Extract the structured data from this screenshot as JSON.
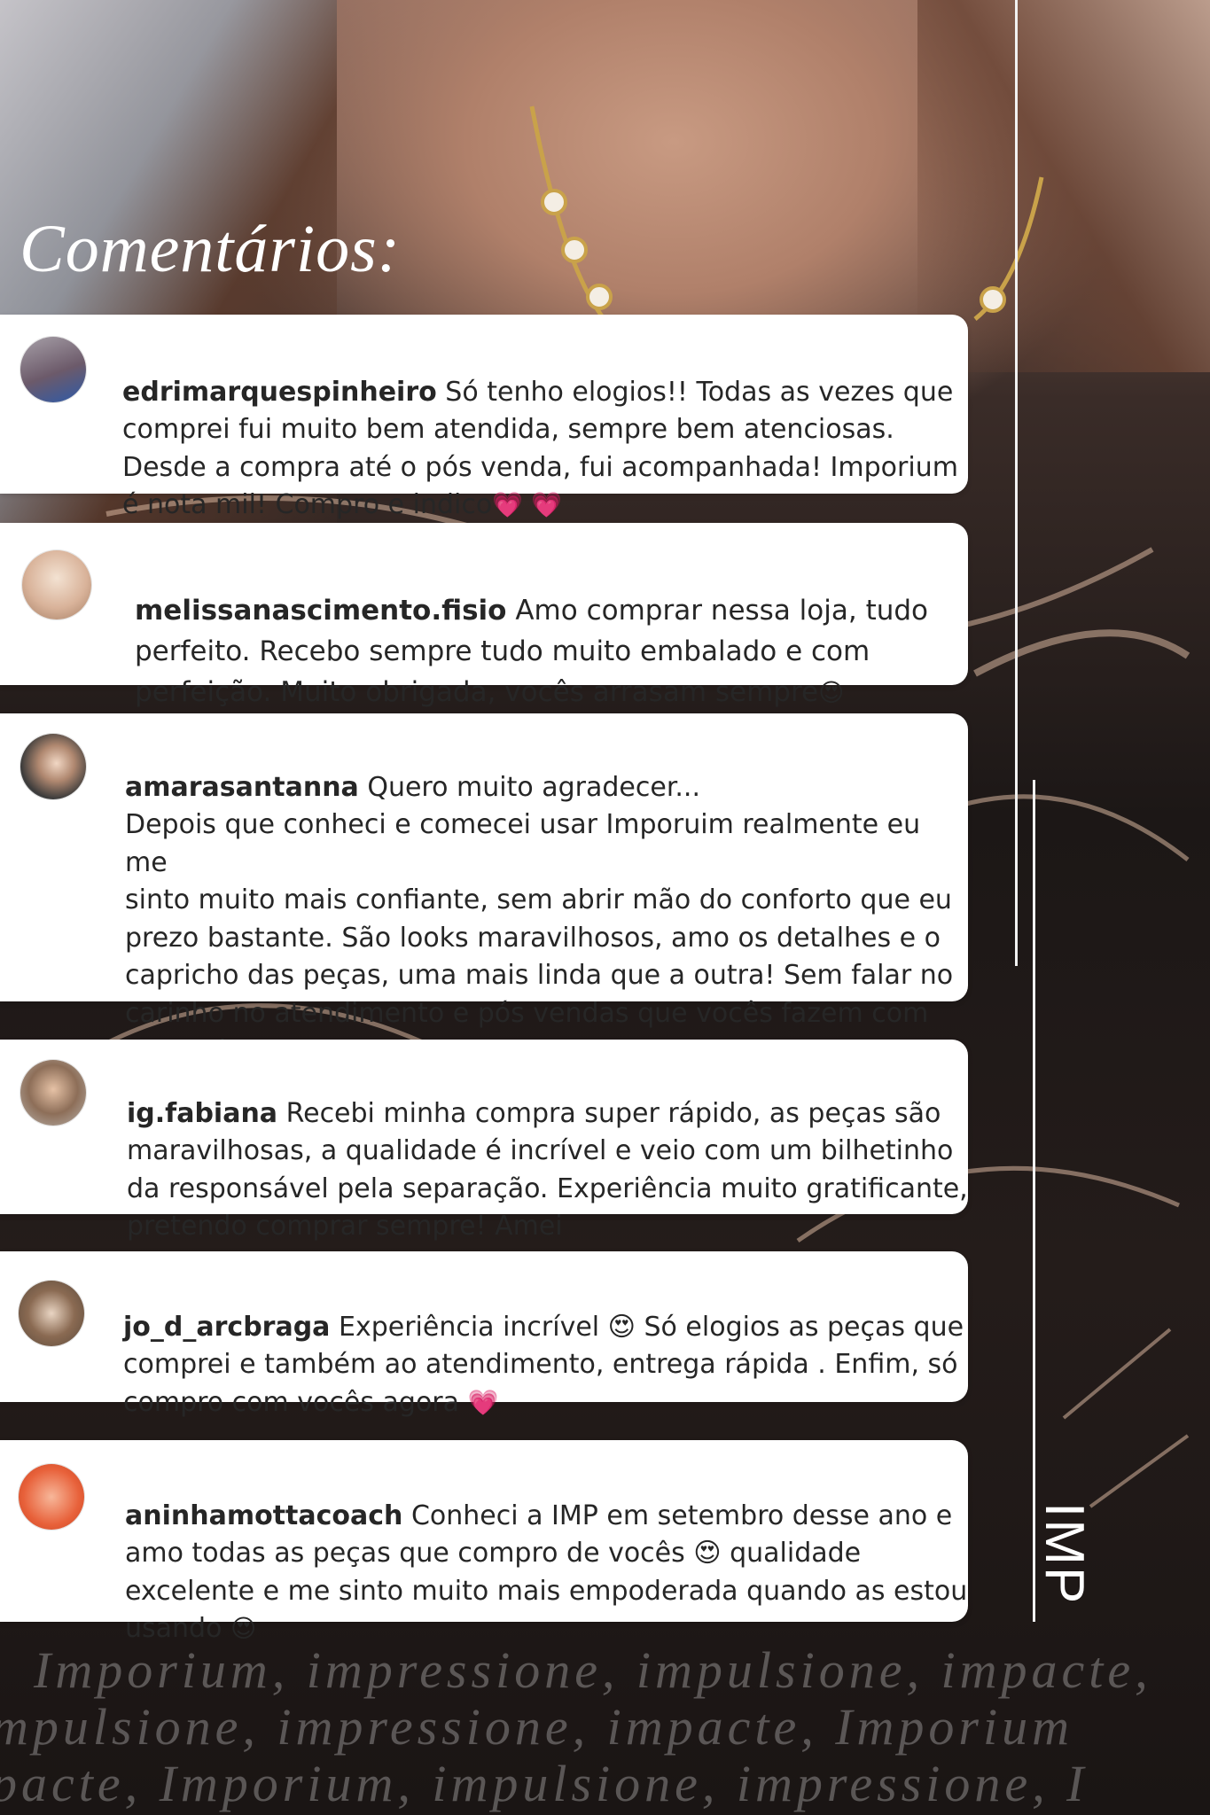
{
  "title": "Comentários:",
  "brand_vertical": "IMP",
  "comments": [
    {
      "user": "edrimarquespinheiro",
      "text": "Só tenho elogios!! Todas as vezes que\ncomprei fui muito bem atendida, sempre bem atenciosas.\nDesde a compra até o pós venda, fui acompanhada! Imporium\né nota mil! Compro e indico",
      "emoji": "💗 💗",
      "avatar_color": "#6c5a6a"
    },
    {
      "user": "melissanascimento.fisio",
      "text": "Amo comprar nessa loja, tudo\nperfeito. Recebo sempre tudo muito embalado e com\nperfeição. Muito obrigada, vocês arrasam sempre",
      "emoji": "😍",
      "avatar_color": "#d9b39a"
    },
    {
      "user": "amarasantanna",
      "text": "Quero muito agradecer...\nDepois que conheci e comecei usar Imporuim realmente eu me\nsinto muito mais confiante, sem abrir mão do conforto que eu\nprezo bastante. São looks maravilhosos, amo os detalhes e o\ncapricho das peças, uma mais linda que a outra! Sem falar no\ncarinho no atendimento e pós vendas que vocês fazem com\nmaestria!",
      "emoji": "🫶🏻 🫶🏻 🫶🏻",
      "avatar_color": "#3a3a3a"
    },
    {
      "user": "ig.fabiana",
      "text": "Recebi minha compra super rápido, as peças são\nmaravilhosas, a qualidade é incrível e veio com um bilhetinho\nda responsável pela separação. Experiência muito gratificante,\npretendo comprar sempre! Amei",
      "emoji": "",
      "avatar_color": "#8d6e58"
    },
    {
      "user": "jo_d_arcbraga",
      "text": "Experiência incrível 😍 Só elogios as peças que\ncomprei e também ao atendimento, entrega rápida . Enfim, só\ncompro com vocês agora",
      "emoji": "💗",
      "avatar_color": "#5b4a3c"
    },
    {
      "user": "aninhamottacoach",
      "text": "Conheci a IMP em setembro desse ano e\namo todas as peças que compro de vocês 😍 qualidade\nexcelente e me sinto muito mais empoderada quando as estou\nusando",
      "emoji": "😍",
      "avatar_color": "#e8613a"
    }
  ],
  "tagline_lines": [
    "Imporium, impressione, impulsione, impacte,",
    "mpulsione, impressione, impacte, Imporium",
    "pacte, Imporium, impulsione, impressione, I"
  ]
}
